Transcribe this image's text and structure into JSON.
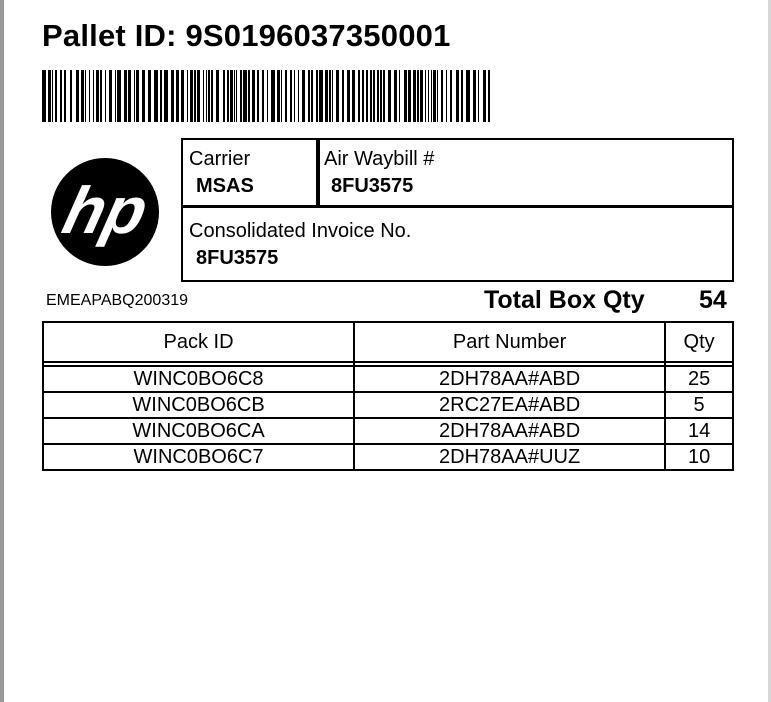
{
  "label": {
    "pallet_id_prefix": "Pallet ID: ",
    "pallet_id": "9S0196037350001",
    "logo_text": "hp",
    "carrier": {
      "label": "Carrier",
      "value": "MSAS"
    },
    "air_waybill": {
      "label": "Air Waybill #",
      "value": "8FU3575"
    },
    "invoice": {
      "label": "Consolidated Invoice No.",
      "value": "8FU3575"
    },
    "reference_code": "EMEAPABQ200319",
    "total_box_qty": {
      "label": "Total Box Qty",
      "value": "54"
    }
  },
  "packs_table": {
    "headers": [
      "Pack ID",
      "Part Number",
      "Qty"
    ],
    "rows": [
      {
        "pack_id": "WINC0BO6C8",
        "part_number": "2DH78AA#ABD",
        "qty": "25"
      },
      {
        "pack_id": "WINC0BO6CB",
        "part_number": "2RC27EA#ABD",
        "qty": "5"
      },
      {
        "pack_id": "WINC0BO6CA",
        "part_number": "2DH78AA#ABD",
        "qty": "14"
      },
      {
        "pack_id": "WINC0BO6C7",
        "part_number": "2DH78AA#UUZ",
        "qty": "10"
      }
    ]
  }
}
